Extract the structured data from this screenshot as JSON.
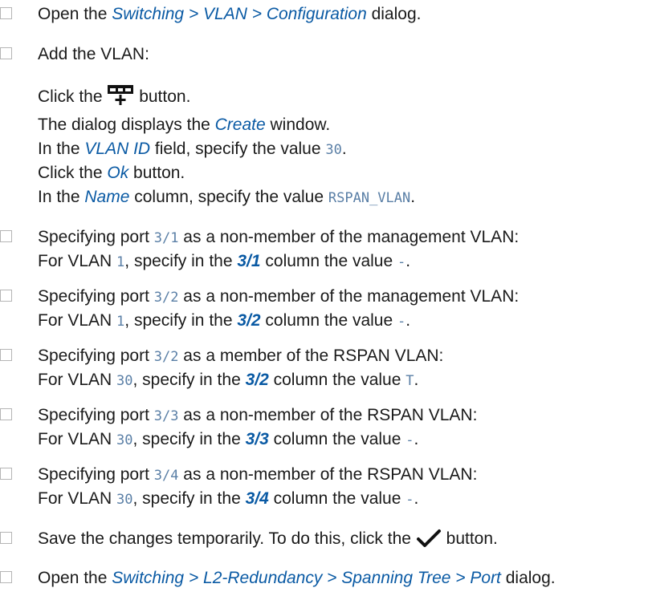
{
  "steps": [
    {
      "p1": "Open the ",
      "ui": "Switching > VLAN > Configuration",
      "p2": " dialog."
    },
    {
      "text": "Add the VLAN:"
    },
    {
      "sub": [
        {
          "p1": "Click the ",
          "p2": " button."
        },
        {
          "p1": "The dialog displays the ",
          "ui": "Create",
          "p2": " window."
        },
        {
          "p1": "In the ",
          "ui": "VLAN ID",
          "p2": " field, specify the value ",
          "code": "30",
          "p3": "."
        },
        {
          "p1": "Click the ",
          "ui": "Ok",
          "p2": " button."
        },
        {
          "p1": "In the ",
          "ui": "Name",
          "p2": " column, specify the value ",
          "code": "RSPAN_VLAN",
          "p3": "."
        }
      ]
    },
    {
      "a1": "Specifying port ",
      "port": "3/1",
      "a2": " as a non-member of the management VLAN:",
      "b1": "For VLAN ",
      "vlan": "1",
      "b2": ", specify in the ",
      "col": "3/1",
      "b3": " column the value ",
      "val": "-",
      "b4": "."
    },
    {
      "a1": "Specifying port ",
      "port": "3/2",
      "a2": " as a non-member of the management VLAN:",
      "b1": "For VLAN ",
      "vlan": "1",
      "b2": ", specify in the ",
      "col": "3/2",
      "b3": " column the value ",
      "val": "-",
      "b4": "."
    },
    {
      "a1": "Specifying port ",
      "port": "3/2",
      "a2": " as a member of the RSPAN VLAN:",
      "b1": "For VLAN ",
      "vlan": "30",
      "b2": ", specify in the ",
      "col": "3/2",
      "b3": " column the value ",
      "val": "T",
      "b4": "."
    },
    {
      "a1": "Specifying port ",
      "port": "3/3",
      "a2": " as a non-member of the RSPAN VLAN:",
      "b1": "For VLAN ",
      "vlan": "30",
      "b2": ", specify in the ",
      "col": "3/3",
      "b3": " column the value ",
      "val": "-",
      "b4": "."
    },
    {
      "a1": "Specifying port ",
      "port": "3/4",
      "a2": " as a non-member of the RSPAN VLAN:",
      "b1": "For VLAN ",
      "vlan": "30",
      "b2": ", specify in the ",
      "col": "3/4",
      "b3": " column the value ",
      "val": "-",
      "b4": "."
    },
    {
      "p1": "Save the changes temporarily. To do this, click the ",
      "p2": " button."
    },
    {
      "p1": "Open the ",
      "ui": "Switching > L2-Redundancy > Spanning Tree > Port",
      "p2": " dialog."
    }
  ],
  "icons": {
    "add": "add-table-row-icon",
    "save": "checkmark-icon"
  }
}
